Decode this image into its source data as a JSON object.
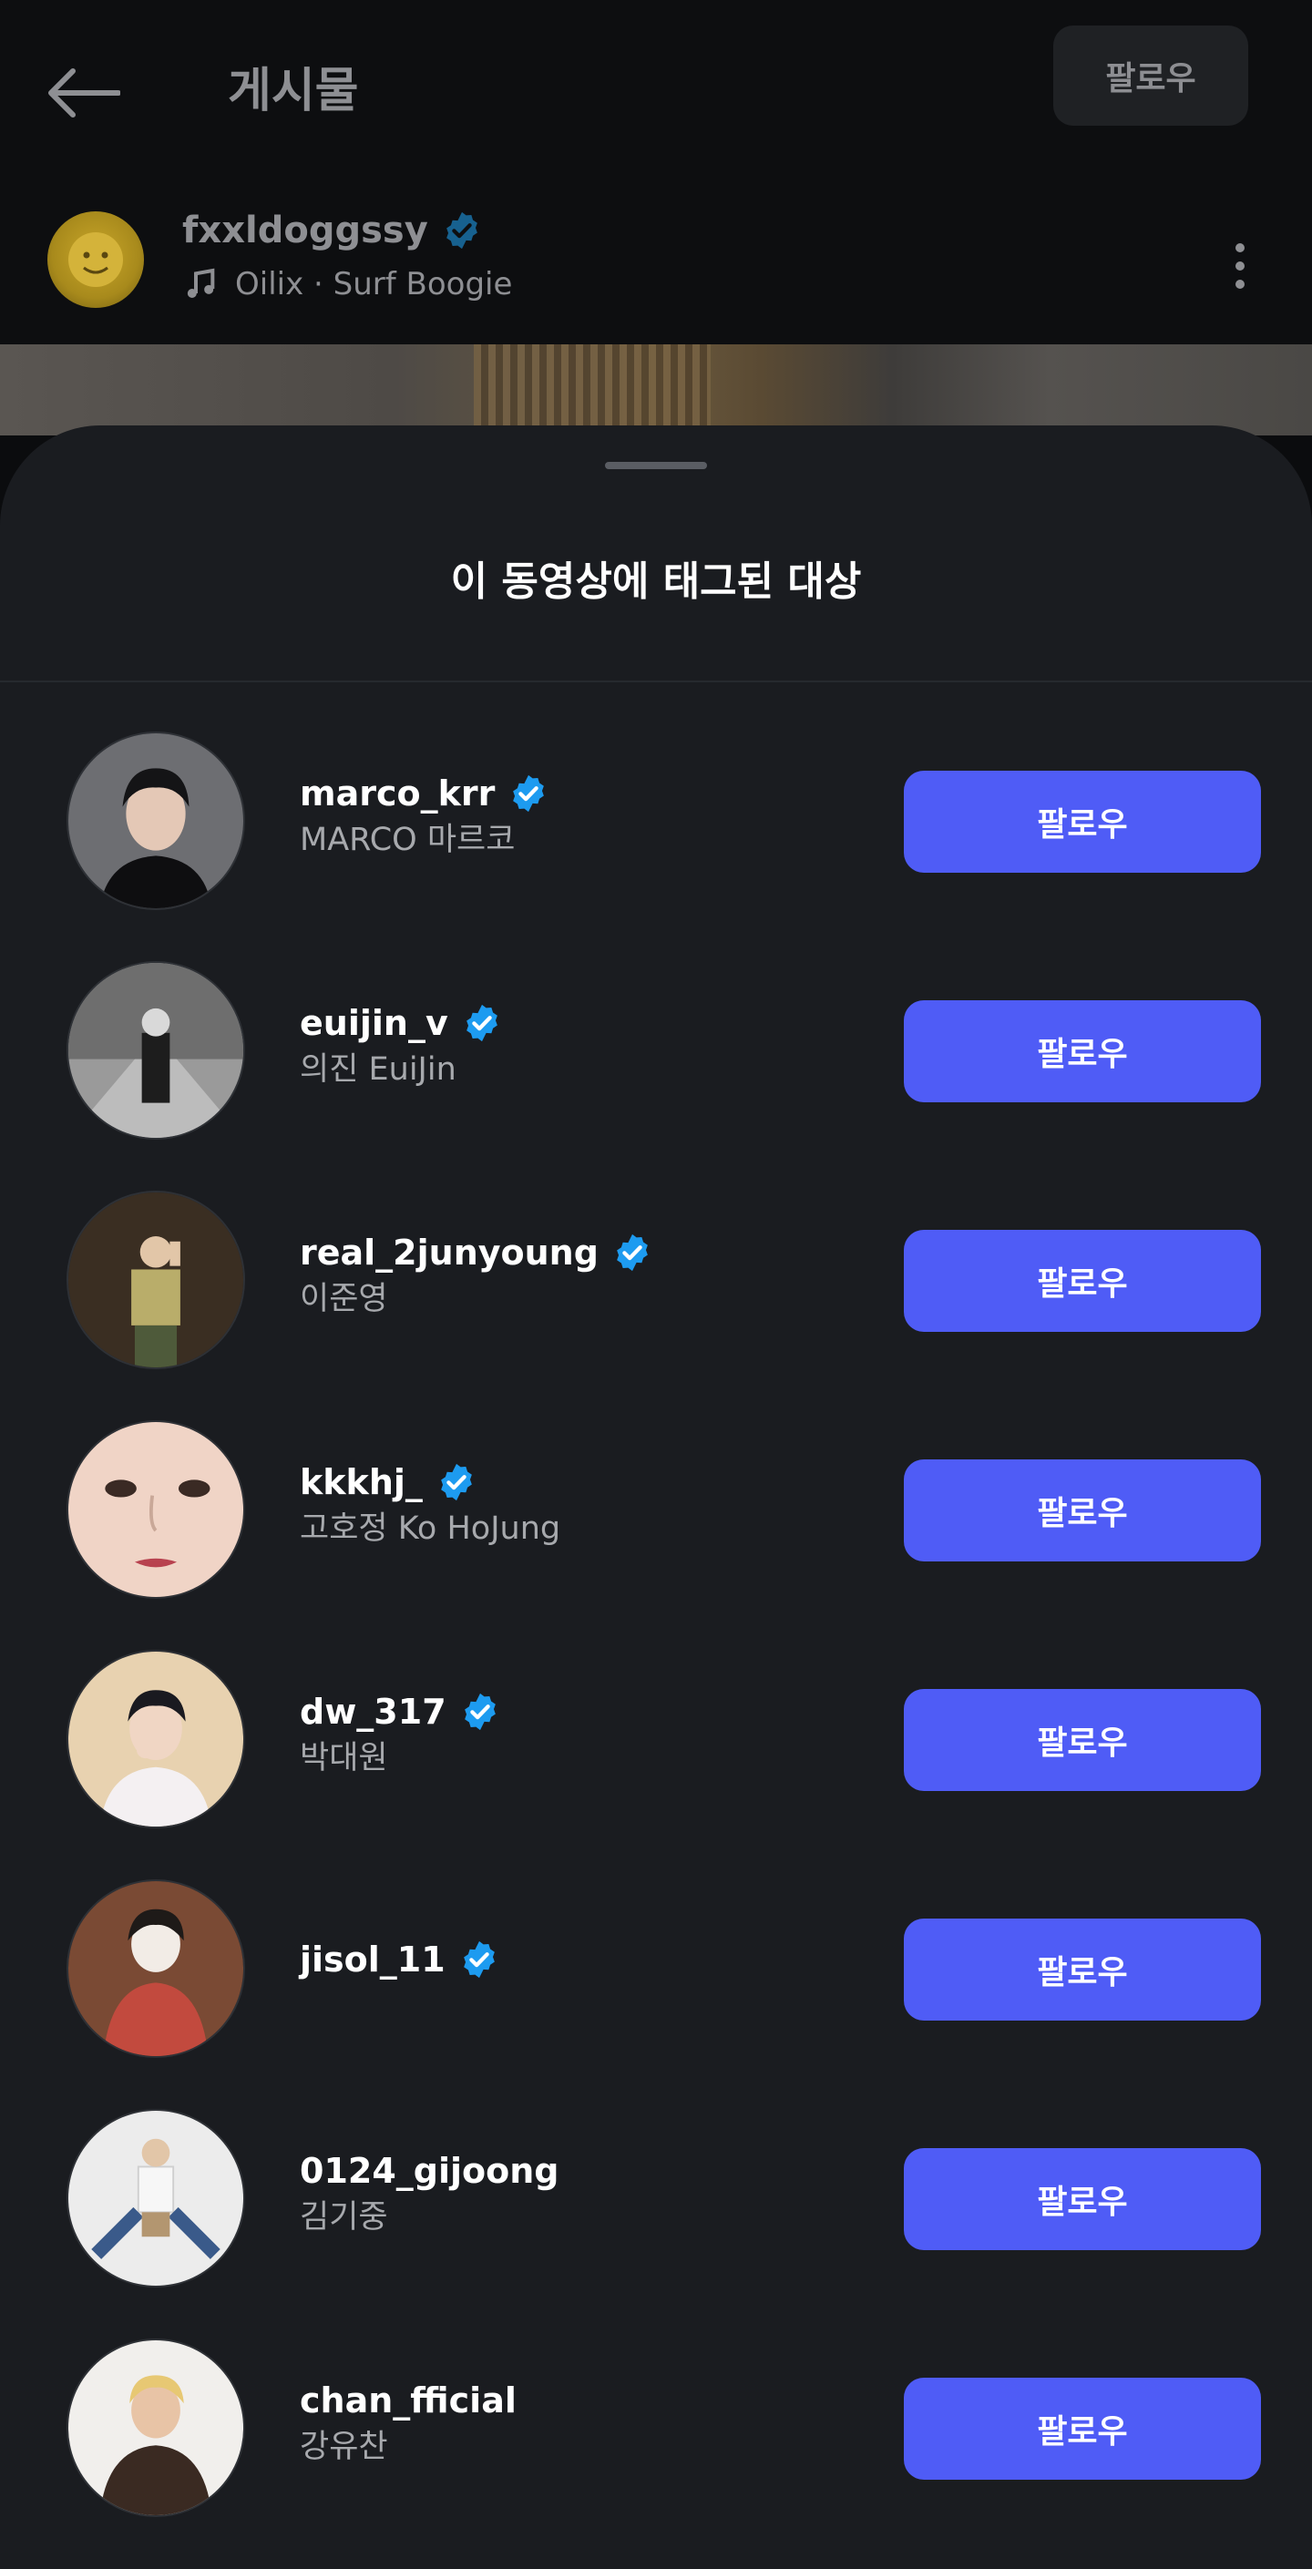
{
  "header": {
    "title": "게시물",
    "follow_label": "팔로우"
  },
  "post_author": {
    "username": "fxxldoggssy",
    "verified": true,
    "music": "Oilix · Surf Boogie"
  },
  "sheet": {
    "title": "이 동영상에 태그된 대상"
  },
  "tagged_users": [
    {
      "username": "marco_krr",
      "name": "MARCO 마르코",
      "verified": true,
      "follow_label": "팔로우"
    },
    {
      "username": "euijin_v",
      "name": "의진 EuiJin",
      "verified": true,
      "follow_label": "팔로우"
    },
    {
      "username": "real_2junyoung",
      "name": "이준영",
      "verified": true,
      "follow_label": "팔로우"
    },
    {
      "username": "kkkhj_",
      "name": "고호정 Ko HoJung",
      "verified": true,
      "follow_label": "팔로우"
    },
    {
      "username": "dw_317",
      "name": "박대원",
      "verified": true,
      "follow_label": "팔로우"
    },
    {
      "username": "jisol_11",
      "name": "",
      "verified": true,
      "follow_label": "팔로우"
    },
    {
      "username": "0124_gijoong",
      "name": "김기중",
      "verified": false,
      "follow_label": "팔로우"
    },
    {
      "username": "chan_fficial",
      "name": "강유찬",
      "verified": false,
      "follow_label": "팔로우"
    }
  ],
  "colors": {
    "follow_button": "#4f5cf6",
    "verified_badge": "#1d9bf0",
    "sheet_background": "#1a1c20"
  }
}
